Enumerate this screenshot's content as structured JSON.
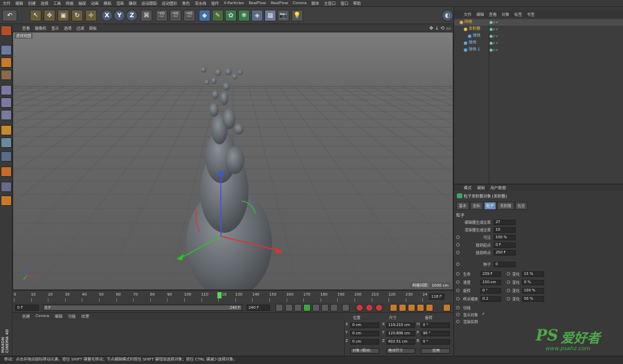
{
  "menu": [
    "文件",
    "编辑",
    "创建",
    "选择",
    "工具",
    "网格",
    "捕捉",
    "动画",
    "模拟",
    "渲染",
    "雕刻",
    "运动跟踪",
    "运动图形",
    "角色",
    "流水线",
    "插件",
    "X-Particles",
    "RealFlow",
    "RealFlow",
    "Corona",
    "脚本",
    "主窗口",
    "窗口",
    "帮助"
  ],
  "toolbar": {
    "x": "X",
    "y": "Y",
    "z": "Z"
  },
  "viewport": {
    "menu": [
      "查看",
      "摄像机",
      "显示",
      "选项",
      "过滤",
      "面板"
    ],
    "label": "透视视图",
    "grid_info": "网格间距：1000 cm"
  },
  "timeline": {
    "ticks": [
      "0",
      "10",
      "20",
      "30",
      "40",
      "50",
      "60",
      "70",
      "80",
      "90",
      "100",
      "110",
      "118",
      "130",
      "140",
      "150",
      "160",
      "170",
      "180",
      "190",
      "200",
      "210",
      "220",
      "230",
      "24"
    ],
    "current_frame": "118 F",
    "start": "0 F",
    "min": "0 F",
    "max": "240 F",
    "end": "240 F"
  },
  "material": {
    "menu": [
      "创建",
      "Corona",
      "编辑",
      "功能",
      "纹理"
    ]
  },
  "coords": {
    "headers": [
      "位置",
      "尺寸",
      "旋转"
    ],
    "rows": [
      {
        "axis": "X",
        "pos": "0 cm",
        "saxis": "X",
        "size": "119.215 cm",
        "raxis": "H",
        "rot": "0 °"
      },
      {
        "axis": "Y",
        "pos": "0 cm",
        "saxis": "Y",
        "size": "120.806 cm",
        "raxis": "P",
        "rot": "90 °"
      },
      {
        "axis": "Z",
        "pos": "0 cm",
        "saxis": "Z",
        "size": "602.51 cm",
        "raxis": "B",
        "rot": "0 °"
      }
    ],
    "mode1": "对象 (相对)",
    "mode2": "绝对尺寸",
    "apply": "应用"
  },
  "status": "移动：点击并拖动鼠标移动元素。按住 SHIFT 键量化移动；节点编辑模式时按住 SHIFT 键增加选择对象；按住 CTRL 键减少选择对象。",
  "objects": {
    "tabs": [
      "文件",
      "编辑",
      "查看",
      "对象",
      "标签",
      "书签"
    ],
    "items": [
      {
        "name": "网格",
        "indent": 0,
        "color": "#e6a640",
        "selected": true
      },
      {
        "name": "发射器",
        "indent": 1,
        "color": "#e6c34a",
        "selected": false
      },
      {
        "name": "球体",
        "indent": 2,
        "color": "#5aa8e6",
        "selected": false
      },
      {
        "name": "球体",
        "indent": 1,
        "color": "#5aa8e6",
        "selected": false
      },
      {
        "name": "球体.1",
        "indent": 1,
        "color": "#5aa8e6",
        "selected": false
      }
    ]
  },
  "attributes": {
    "tabs": [
      "模式",
      "编辑",
      "用户数据"
    ],
    "title": "粒子发射器对象 [发射器]",
    "subtabs": [
      "基本",
      "坐标",
      "粒子",
      "发射器",
      "包含"
    ],
    "active_subtab": 2,
    "section": "粒子",
    "params": [
      {
        "label": "编辑器生成比率",
        "value": "27"
      },
      {
        "label": "渲染器生成比率",
        "value": "10"
      },
      {
        "label": "可见",
        "value": "100 %"
      },
      {
        "label": "投射起点",
        "value": "0 F"
      },
      {
        "label": "投射终点",
        "value": "250 F"
      },
      {
        "label": "种子",
        "value": "0"
      }
    ],
    "pairs": [
      {
        "label": "生命",
        "value": "239 F",
        "vlabel": "变化",
        "vvalue": "15 %"
      },
      {
        "label": "速度",
        "value": "150 cm",
        "vlabel": "变化",
        "vvalue": "0 %"
      },
      {
        "label": "旋转",
        "value": "0 °",
        "vlabel": "变化",
        "vvalue": "100 %"
      },
      {
        "label": "终点缩放",
        "value": "0.2",
        "vlabel": "变化",
        "vvalue": "50 %"
      }
    ],
    "checks": [
      {
        "label": "切线",
        "mark": ""
      },
      {
        "label": "显示对象",
        "mark": "✓"
      },
      {
        "label": "渲染实例",
        "mark": ""
      }
    ]
  },
  "brand": {
    "ps": "PS",
    "cn": "爱好者",
    "url": "www.psahz.com",
    "logo": "MAXON CINEMA 4D"
  }
}
